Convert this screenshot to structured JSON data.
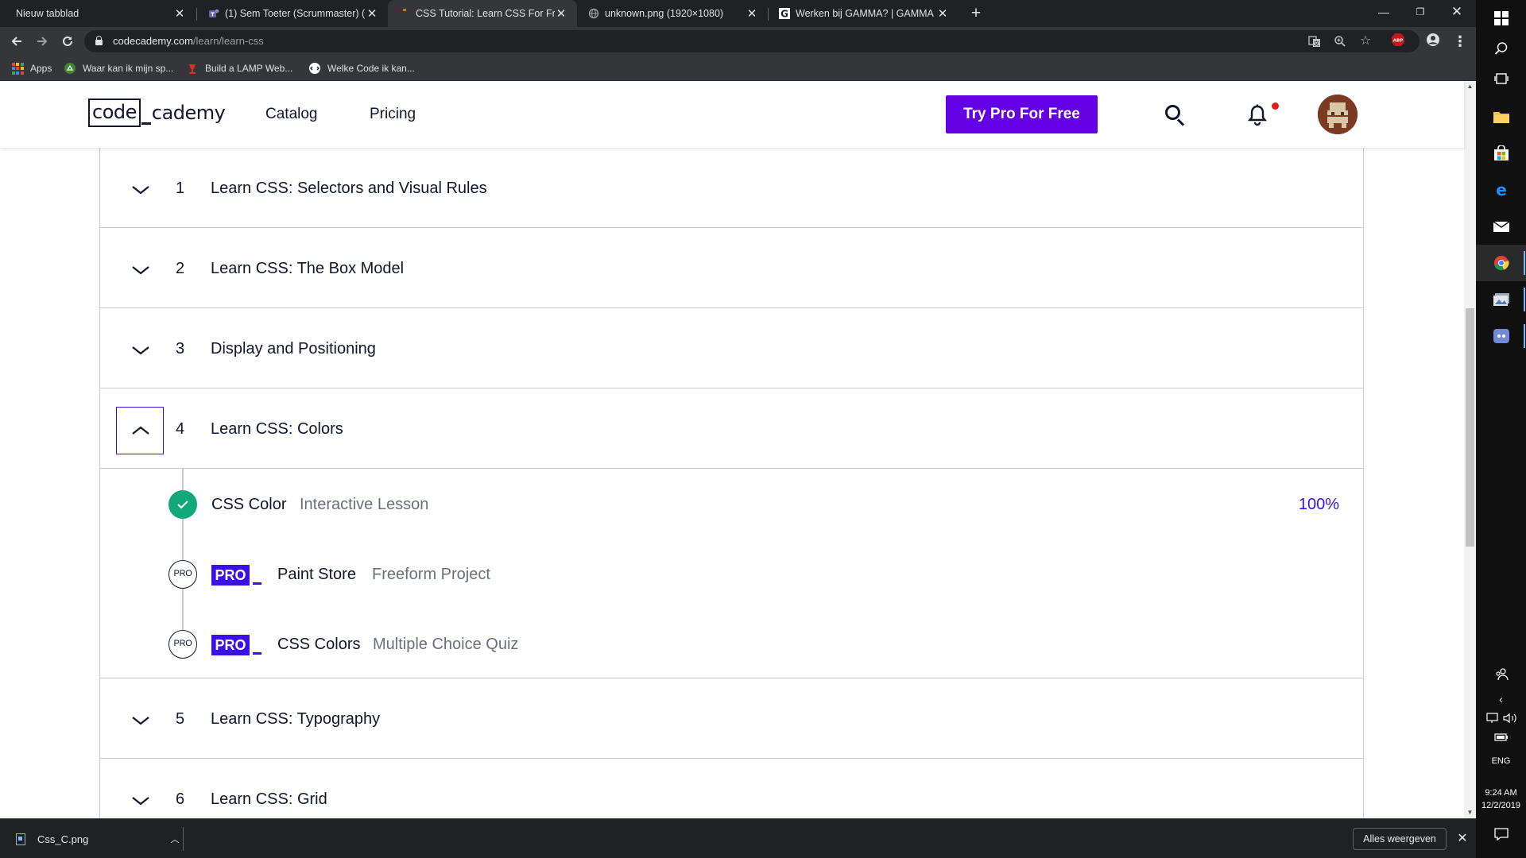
{
  "browser": {
    "tabs": [
      {
        "title": "Nieuw tabblad",
        "favicon": "blank-icon"
      },
      {
        "title": "(1) Sem Toeter (Scrummaster) (C",
        "favicon": "teams-icon"
      },
      {
        "title": "CSS Tutorial: Learn CSS For Free |",
        "favicon": "codecademy-icon",
        "active": true
      },
      {
        "title": "unknown.png (1920×1080)",
        "favicon": "globe-icon"
      },
      {
        "title": "Werken bij GAMMA? | GAMMA",
        "favicon": "gamma-icon"
      }
    ],
    "url_host": "codecademy.com",
    "url_path": "/learn/learn-css",
    "bookmarks": [
      {
        "label": "Apps",
        "icon": "apps-grid-icon"
      },
      {
        "label": "Waar kan ik mijn sp...",
        "icon": "recycle-icon"
      },
      {
        "label": "Build a LAMP Web...",
        "icon": "lamp-icon"
      },
      {
        "label": "Welke Code ik kan...",
        "icon": "code-icon"
      }
    ],
    "extension_badge": "ABP"
  },
  "site": {
    "logo_code": "code",
    "logo_rest": "cademy",
    "nav": [
      "Catalog",
      "Pricing"
    ],
    "cta": "Try Pro For Free",
    "accent": "#6400e4",
    "brand_blue": "#3a10e5"
  },
  "syllabus": {
    "modules": [
      {
        "num": "1",
        "title": "Learn CSS: Selectors and Visual Rules",
        "expanded": false
      },
      {
        "num": "2",
        "title": "Learn CSS: The Box Model",
        "expanded": false
      },
      {
        "num": "3",
        "title": "Display and Positioning",
        "expanded": false
      },
      {
        "num": "4",
        "title": "Learn CSS: Colors",
        "expanded": true
      },
      {
        "num": "5",
        "title": "Learn CSS: Typography",
        "expanded": false
      },
      {
        "num": "6",
        "title": "Learn CSS: Grid",
        "expanded": false
      }
    ],
    "lessons": [
      {
        "name": "CSS Color",
        "type": "Interactive Lesson",
        "status": "complete",
        "progress": "100%"
      },
      {
        "name": "Paint Store",
        "type": "Freeform Project",
        "status_label": "PRO",
        "badge": "PRO"
      },
      {
        "name": "CSS Colors",
        "type": "Multiple Choice Quiz",
        "status_label": "PRO",
        "badge": "PRO"
      }
    ]
  },
  "downloads": {
    "file": "Css_C.png",
    "show_all": "Alles weergeven"
  },
  "taskbar": {
    "language": "ENG",
    "time": "9:24 AM",
    "date": "12/2/2019"
  }
}
